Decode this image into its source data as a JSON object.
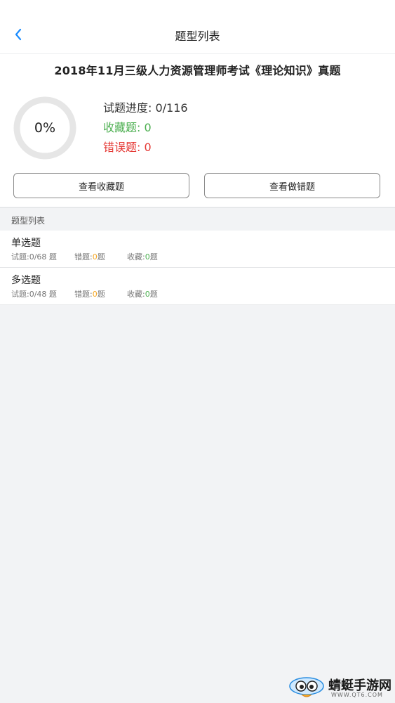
{
  "header": {
    "title": "题型列表"
  },
  "exam": {
    "title": "2018年11月三级人力资源管理师考试《理论知识》真题"
  },
  "progress": {
    "percent_text": "0%",
    "fraction": 0,
    "progress_text": "试题进度: 0/116",
    "favorites_text": "收藏题: 0",
    "wrong_text": "错误题: 0"
  },
  "buttons": {
    "view_favorites": "查看收藏题",
    "view_wrong": "查看做错题"
  },
  "section": {
    "label": "题型列表"
  },
  "types": [
    {
      "name": "单选题",
      "total_label": "试题:0/68 题",
      "wrong_prefix": "错题:",
      "wrong_count": "0",
      "wrong_suffix": "题",
      "fav_prefix": "收藏:",
      "fav_count": "0",
      "fav_suffix": "题"
    },
    {
      "name": "多选题",
      "total_label": "试题:0/48 题",
      "wrong_prefix": "错题:",
      "wrong_count": "0",
      "wrong_suffix": "题",
      "fav_prefix": "收藏:",
      "fav_count": "0",
      "fav_suffix": "题"
    }
  ],
  "watermark": {
    "name": "蜻蜓手游网",
    "url": "WWW.QT6.COM"
  },
  "colors": {
    "accent": "#1a8cff",
    "favorite": "#4caf50",
    "wrong": "#e53935",
    "wrong_count": "#f5a623",
    "ring_track": "#e6e6e6"
  }
}
